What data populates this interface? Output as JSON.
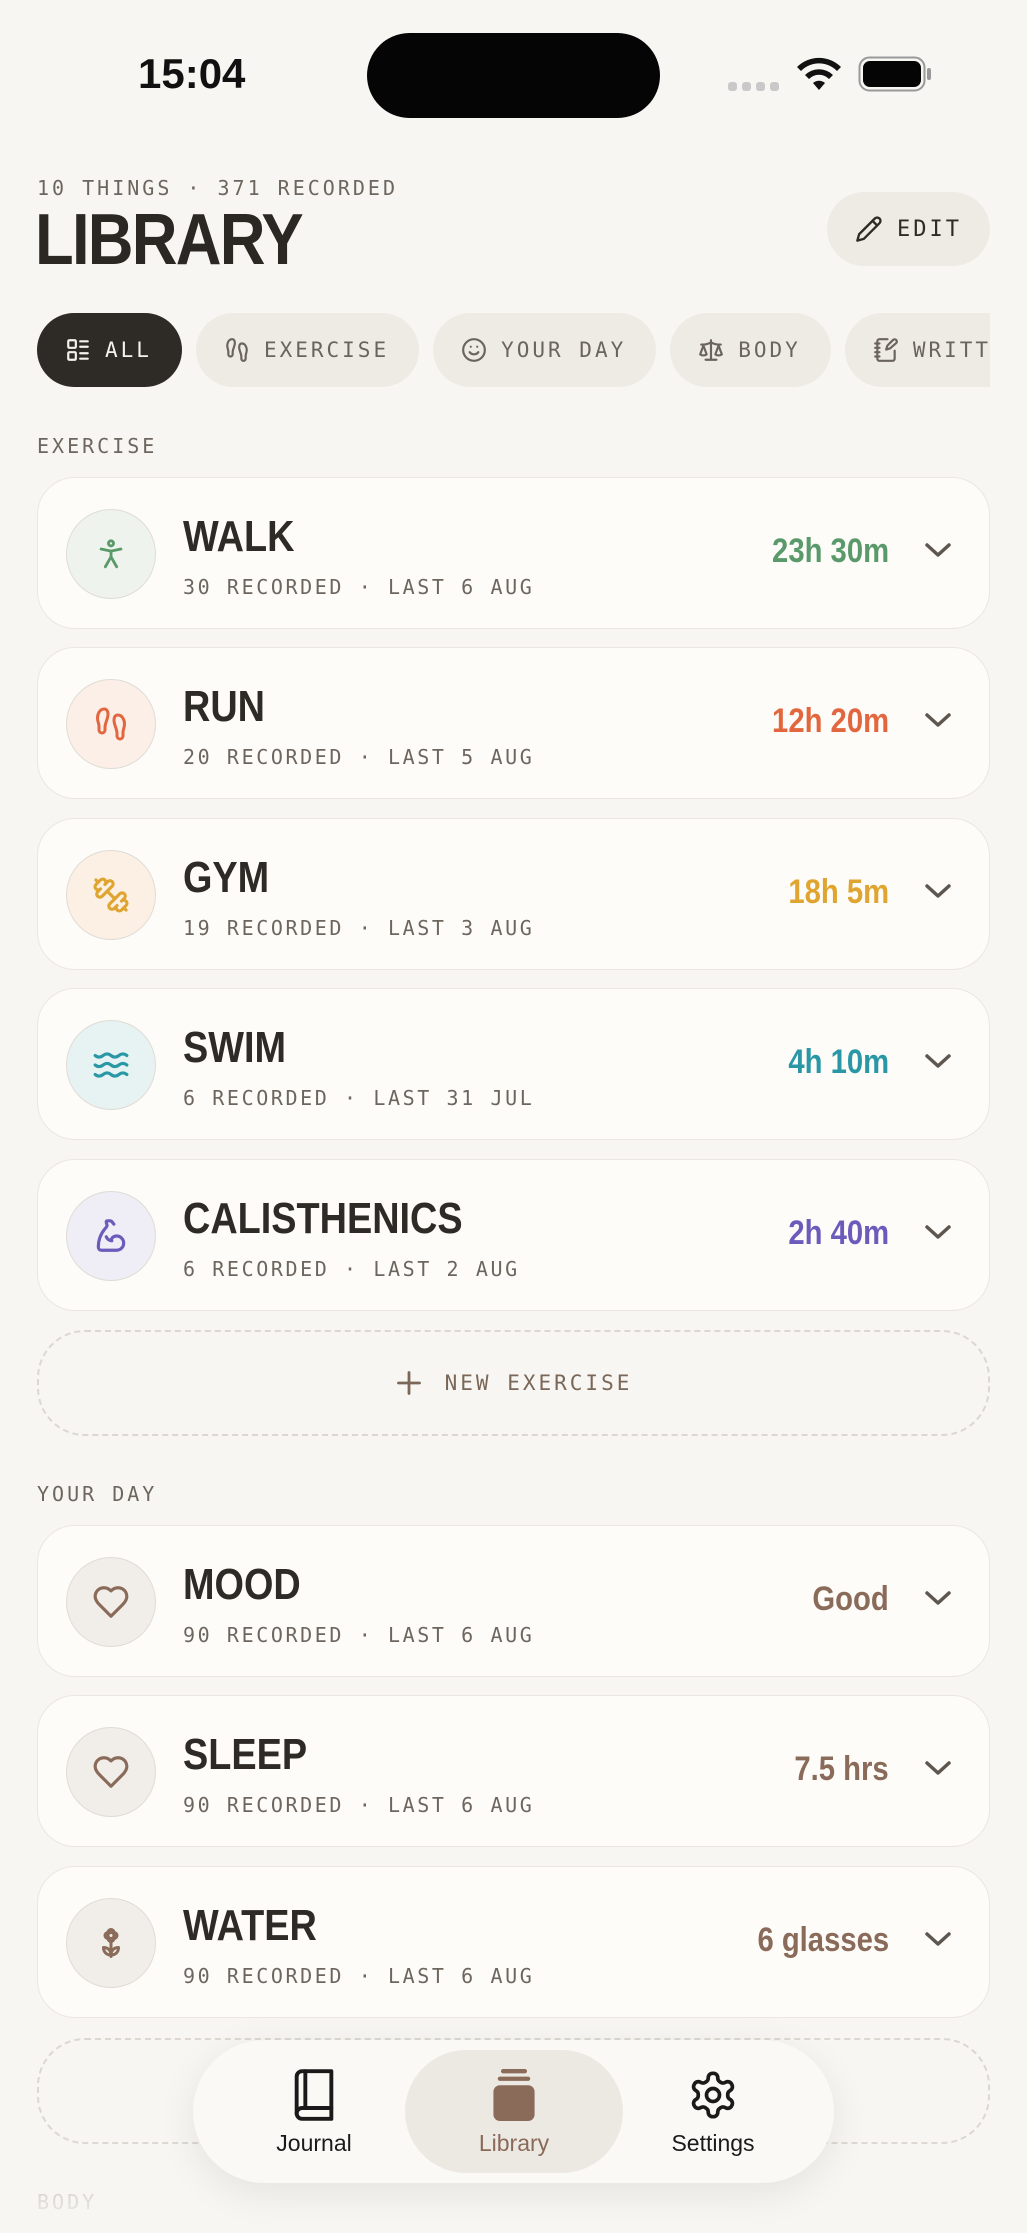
{
  "status": {
    "time": "15:04"
  },
  "header": {
    "subtitle": "10 THINGS · 371 RECORDED",
    "title": "LIBRARY",
    "edit_label": "EDIT"
  },
  "filters": [
    {
      "label": "ALL",
      "icon": "list-icon",
      "active": true
    },
    {
      "label": "EXERCISE",
      "icon": "footprints-icon",
      "active": false
    },
    {
      "label": "YOUR DAY",
      "icon": "smile-icon",
      "active": false
    },
    {
      "label": "BODY",
      "icon": "scale-icon",
      "active": false
    },
    {
      "label": "WRITTEN",
      "icon": "notebook-pen-icon",
      "active": false
    }
  ],
  "sections": {
    "exercise": {
      "label": "EXERCISE",
      "items": [
        {
          "name": "WALK",
          "meta": "30 RECORDED · LAST 6 AUG",
          "value": "23h 30m",
          "icon": "walk-icon",
          "color": "#5a9a6a",
          "bg": "#eef3ee"
        },
        {
          "name": "RUN",
          "meta": "20 RECORDED · LAST 5 AUG",
          "value": "12h 20m",
          "icon": "footprints-icon",
          "color": "#e2673f",
          "bg": "#fcefe8"
        },
        {
          "name": "GYM",
          "meta": "19 RECORDED · LAST 3 AUG",
          "value": "18h 5m",
          "icon": "dumbbell-icon",
          "color": "#e0a531",
          "bg": "#fcf0e4"
        },
        {
          "name": "SWIM",
          "meta": "6 RECORDED · LAST 31 JUL",
          "value": "4h 10m",
          "icon": "waves-icon",
          "color": "#2a97a6",
          "bg": "#e6f3f2"
        },
        {
          "name": "CALISTHENICS",
          "meta": "6 RECORDED · LAST 2 AUG",
          "value": "2h 40m",
          "icon": "biceps-icon",
          "color": "#6b5cbb",
          "bg": "#efedf6"
        }
      ],
      "new_label": "NEW EXERCISE"
    },
    "your_day": {
      "label": "YOUR DAY",
      "items": [
        {
          "name": "MOOD",
          "meta": "90 RECORDED · LAST 6 AUG",
          "value": "Good",
          "icon": "heart-icon",
          "color": "#8a6b5a",
          "bg": "#f1eeea"
        },
        {
          "name": "SLEEP",
          "meta": "90 RECORDED · LAST 6 AUG",
          "value": "7.5 hrs",
          "icon": "heart-icon",
          "color": "#8a6b5a",
          "bg": "#f1eeea"
        },
        {
          "name": "WATER",
          "meta": "90 RECORDED · LAST 6 AUG",
          "value": "6 glasses",
          "icon": "flower-icon",
          "color": "#8a6b5a",
          "bg": "#f1eeea"
        }
      ]
    },
    "body": {
      "label": "BODY"
    }
  },
  "tabbar": [
    {
      "label": "Journal",
      "icon": "book-icon",
      "active": false
    },
    {
      "label": "Library",
      "icon": "library-icon",
      "active": true
    },
    {
      "label": "Settings",
      "icon": "gear-icon",
      "active": false
    }
  ]
}
